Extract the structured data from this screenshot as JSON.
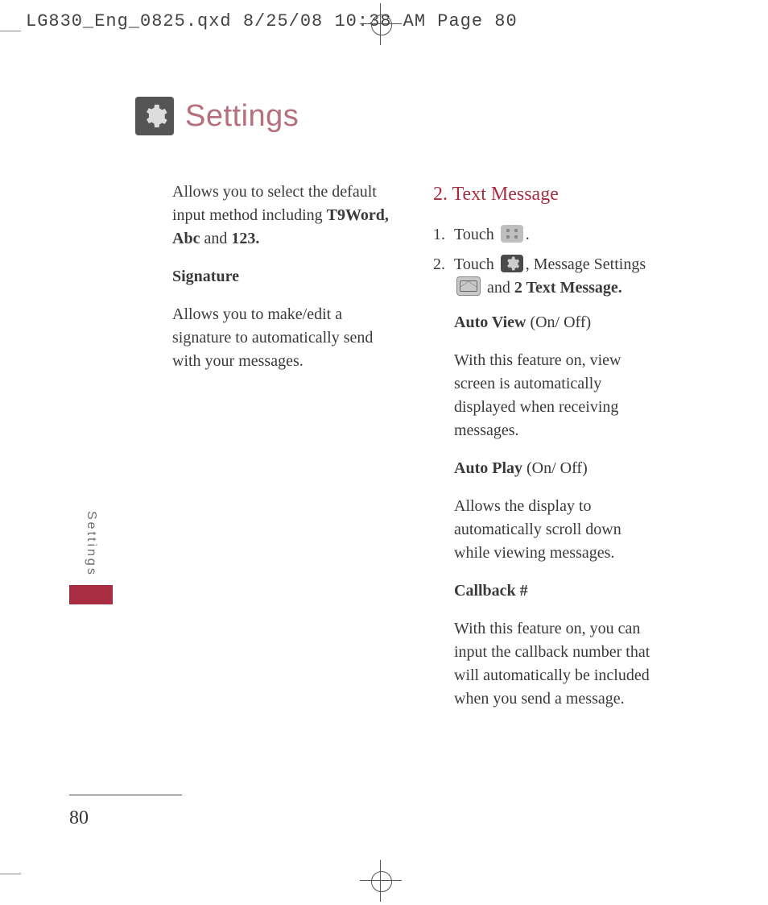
{
  "slug": "LG830_Eng_0825.qxd  8/25/08  10:38 AM  Page 80",
  "title": "Settings",
  "side_tab": "Settings",
  "page_number": "80",
  "left": {
    "p1_a": "Allows you to select the default input method including ",
    "p1_b": "T9Word, Abc",
    "p1_c": " and ",
    "p1_d": "123.",
    "h1": "Signature",
    "p2": "Allows you to make/edit a signature to automatically send with your messages."
  },
  "right": {
    "heading": "2. Text Message",
    "s1_n": "1.",
    "s1_a": "Touch ",
    "s1_b": ".",
    "s2_n": "2.",
    "s2_a": "Touch ",
    "s2_b": ", Message Settings ",
    "s2_c": " and ",
    "s2_d": "2 Text Message.",
    "av_h_a": "Auto View ",
    "av_h_b": "(On/ Off)",
    "av_p": "With this feature on, view screen is automatically displayed when receiving messages.",
    "ap_h_a": "Auto Play ",
    "ap_h_b": "(On/ Off)",
    "ap_p": "Allows the display to automatically scroll down while viewing messages.",
    "cb_h": "Callback #",
    "cb_p": "With this feature on, you can input the callback number that will automatically be included when you send a message."
  }
}
